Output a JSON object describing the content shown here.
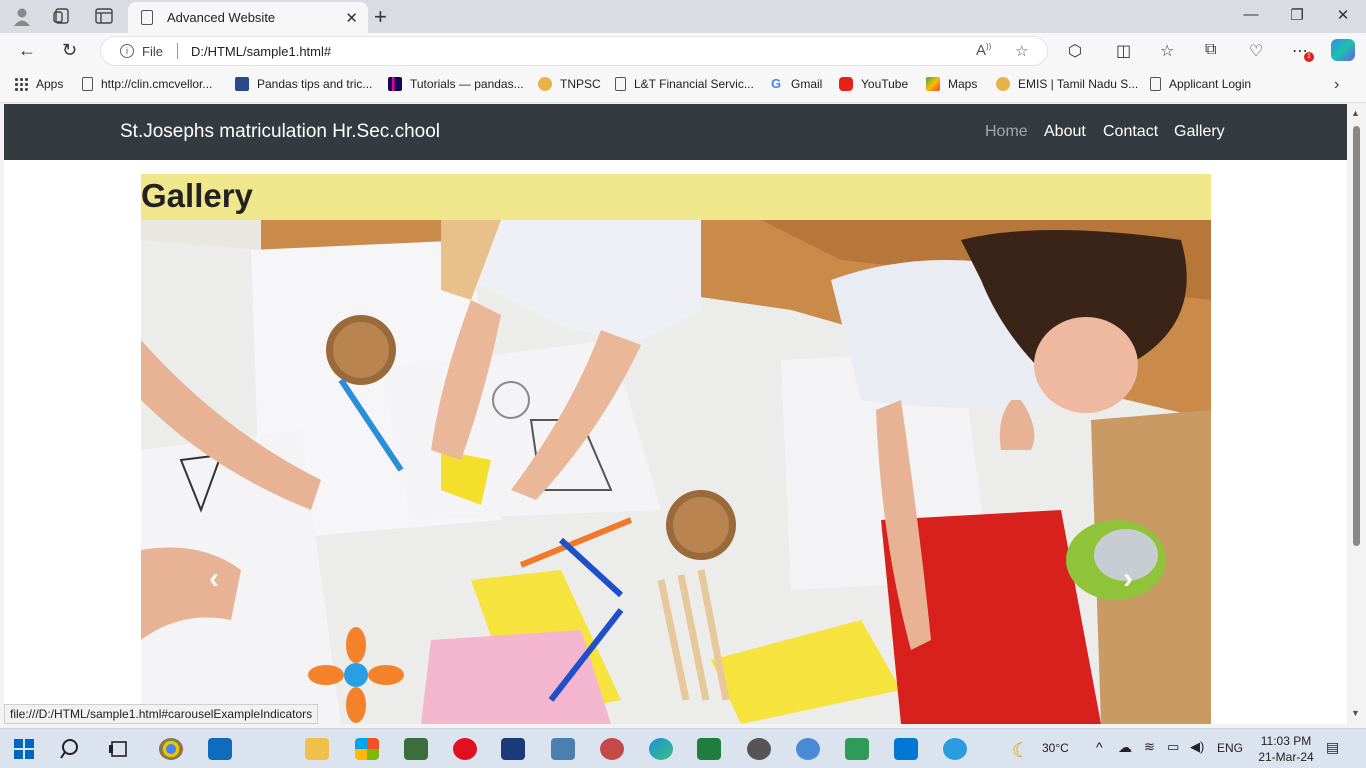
{
  "browser": {
    "tab_title": "Advanced Website",
    "address_scheme": "File",
    "address_url": "D:/HTML/sample1.html#",
    "bookmarks": [
      {
        "label": "Apps",
        "icon": "grid"
      },
      {
        "label": "http://clin.cmcvellor...",
        "icon": "doc"
      },
      {
        "label": "Pandas tips and tric...",
        "icon": "tds"
      },
      {
        "label": "Tutorials — pandas...",
        "icon": "pandas"
      },
      {
        "label": "TNPSC",
        "icon": "emblem"
      },
      {
        "label": "L&T Financial Servic...",
        "icon": "doc"
      },
      {
        "label": "Gmail",
        "icon": "google"
      },
      {
        "label": "YouTube",
        "icon": "yt"
      },
      {
        "label": "Maps",
        "icon": "maps"
      },
      {
        "label": "EMIS | Tamil Nadu S...",
        "icon": "emblem"
      },
      {
        "label": "Applicant Login",
        "icon": "doc"
      }
    ],
    "notification_count": "1",
    "status_url": "file:///D:/HTML/sample1.html#carouselExampleIndicators"
  },
  "site": {
    "brand": "St.Josephs matriculation Hr.Sec.chool",
    "nav": [
      {
        "label": "Home",
        "active": true
      },
      {
        "label": "About"
      },
      {
        "label": "Contact"
      },
      {
        "label": "Gallery"
      }
    ],
    "gallery_title": "Gallery",
    "carousel": {
      "prev_label": "‹",
      "next_label": "›"
    }
  },
  "taskbar": {
    "weather_temp": "30°C",
    "language": "ENG",
    "time": "11:03 PM",
    "date": "21-Mar-24"
  },
  "colors": {
    "navbar": "#343a40",
    "gallery_header": "#f0e68c",
    "accent": "#0067c0"
  }
}
